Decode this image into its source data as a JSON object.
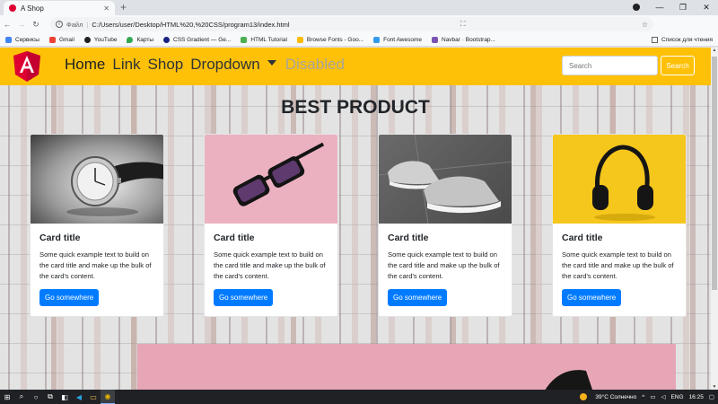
{
  "browser": {
    "tab_title": "A Shop",
    "new_tab_symbol": "+",
    "window_buttons": [
      "—",
      "❐",
      "✕"
    ],
    "scheme_label": "Файл",
    "url": "C:/Users/user/Desktop/HTML%20,%20CSS/program13/index.html",
    "bookmarks": [
      {
        "label": "Сервисы",
        "color": "#4285f4"
      },
      {
        "label": "Gmail",
        "color": "#ea4335"
      },
      {
        "label": "YouTube",
        "color": "#202124"
      },
      {
        "label": "Карты",
        "color": "#34a853"
      },
      {
        "label": "CSS Gradient — Ge...",
        "color": "#1a237e"
      },
      {
        "label": "HTML Tutorial",
        "color": "#4caf50"
      },
      {
        "label": "Browse Fonts - Goo...",
        "color": "#fbbc05"
      },
      {
        "label": "Font Awesome",
        "color": "#339af0"
      },
      {
        "label": "Navbar · Bootstrap...",
        "color": "#7952b3"
      }
    ],
    "reading_list": "Список для чтения"
  },
  "navbar": {
    "brand_color": "#ffc107",
    "links": {
      "home": "Home",
      "link": "Link",
      "shop": "Shop",
      "dropdown": "Dropdown",
      "disabled": "Disabled"
    },
    "search": {
      "placeholder": "Search",
      "button": "Search"
    }
  },
  "main": {
    "heading": "BEST PRODUCT",
    "cards": [
      {
        "image": "watch",
        "title": "Card title",
        "text": "Some quick example text to build on the card title and make up the bulk of the card's content.",
        "button": "Go somewhere"
      },
      {
        "image": "sunglasses",
        "title": "Card title",
        "text": "Some quick example text to build on the card title and make up the bulk of the card's content.",
        "button": "Go somewhere"
      },
      {
        "image": "sneakers",
        "title": "Card title",
        "text": "Some quick example text to build on the card title and make up the bulk of the card's content.",
        "button": "Go somewhere"
      },
      {
        "image": "headphones",
        "title": "Card title",
        "text": "Some quick example text to build on the card title and make up the bulk of the card's content.",
        "button": "Go somewhere"
      }
    ]
  },
  "taskbar": {
    "weather": "39°C  Солнечно",
    "language": "ENG",
    "time": "16:25"
  },
  "colors": {
    "primary": "#007bff",
    "heading": "#212529"
  }
}
